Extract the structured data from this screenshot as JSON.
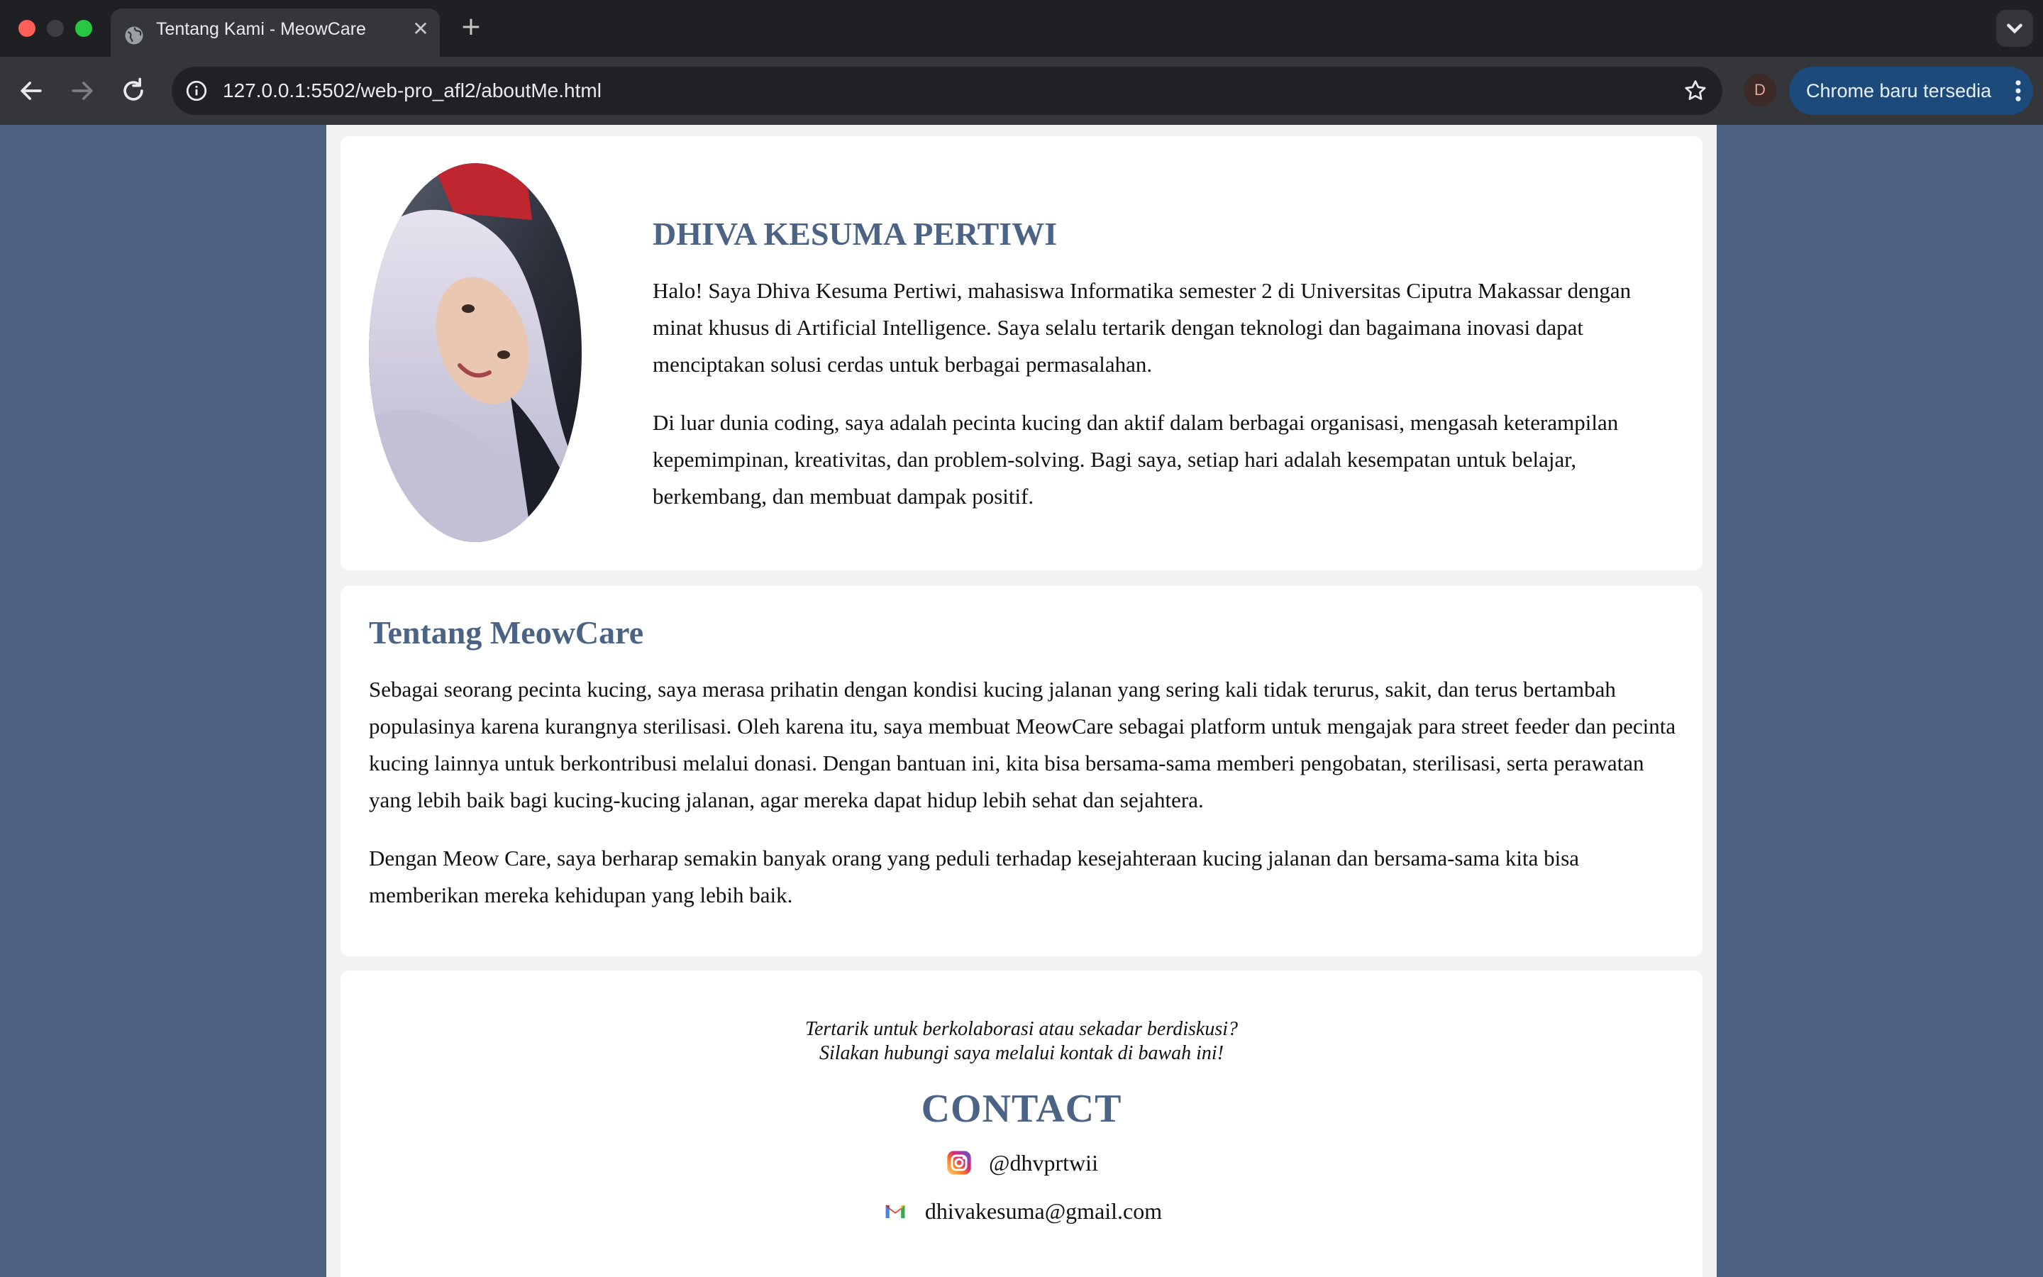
{
  "browser": {
    "tab_title": "Tentang Kami - MeowCare",
    "url": "127.0.0.1:5502/web-pro_afl2/aboutMe.html",
    "profile_initial": "D",
    "update_label": "Chrome baru tersedia",
    "new_tab_symbol": "+",
    "close_symbol": "✕"
  },
  "profile": {
    "name": "DHIVA KESUMA PERTIWI",
    "paragraphs": [
      "Halo! Saya Dhiva Kesuma Pertiwi, mahasiswa Informatika semester 2 di Universitas Ciputra Makassar dengan minat khusus di Artificial Intelligence. Saya selalu tertarik dengan teknologi dan bagaimana inovasi dapat menciptakan solusi cerdas untuk berbagai permasalahan.",
      "Di luar dunia coding, saya adalah pecinta kucing dan aktif dalam berbagai organisasi, mengasah keterampilan kepemimpinan, kreativitas, dan problem-solving. Bagi saya, setiap hari adalah kesempatan untuk belajar, berkembang, dan membuat dampak positif."
    ]
  },
  "about": {
    "title": "Tentang MeowCare",
    "paragraphs": [
      "Sebagai seorang pecinta kucing, saya merasa prihatin dengan kondisi kucing jalanan yang sering kali tidak terurus, sakit, dan terus bertambah populasinya karena kurangnya sterilisasi. Oleh karena itu, saya membuat MeowCare sebagai platform untuk mengajak para street feeder dan pecinta kucing lainnya untuk berkontribusi melalui donasi. Dengan bantuan ini, kita bisa bersama-sama memberi pengobatan, sterilisasi, serta perawatan yang lebih baik bagi kucing-kucing jalanan, agar mereka dapat hidup lebih sehat dan sejahtera.",
      "Dengan Meow Care, saya berharap semakin banyak orang yang peduli terhadap kesejahteraan kucing jalanan dan bersama-sama kita bisa memberikan mereka kehidupan yang lebih baik."
    ]
  },
  "contact": {
    "invite_line1": "Tertarik untuk berkolaborasi atau sekadar berdiskusi?",
    "invite_line2": "Silakan hubungi saya melalui kontak di bawah ini!",
    "title": "CONTACT",
    "instagram": "@dhvprtwii",
    "email": "dhivakesuma@gmail.com"
  },
  "colors": {
    "page_background": "#4e6283",
    "heading": "#4b6384",
    "update_chip": "#1c4a7a"
  },
  "icons": [
    "globe-icon",
    "back-icon",
    "forward-icon",
    "reload-icon",
    "info-icon",
    "star-icon",
    "kebab-menu-icon",
    "instagram-icon",
    "gmail-icon",
    "chevron-down-icon"
  ]
}
